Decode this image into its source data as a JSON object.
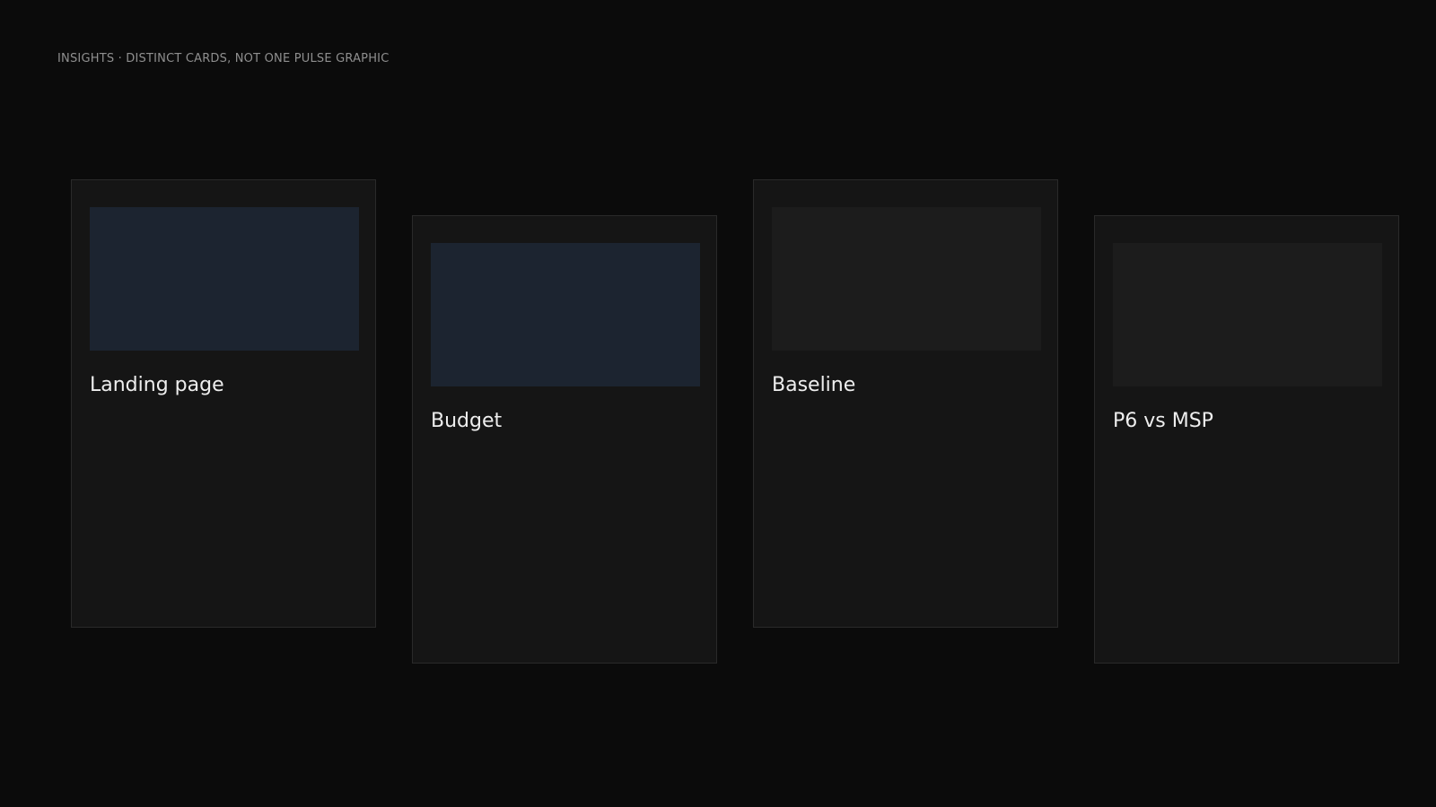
{
  "header": {
    "eyebrow": "INSIGHTS · DISTINCT CARDS, NOT ONE PULSE GRAPHIC"
  },
  "cards": [
    {
      "title": "Landing page",
      "thumb_color": "#1c2430"
    },
    {
      "title": "Budget",
      "thumb_color": "#1c2430"
    },
    {
      "title": "Baseline",
      "thumb_color": "#1c1c1c"
    },
    {
      "title": "P6 vs MSP",
      "thumb_color": "#1c1c1c"
    }
  ],
  "colors": {
    "background": "#0b0b0b",
    "card": "#151515",
    "card_border": "#2a2a2a",
    "eyebrow_text": "#8f8f8f",
    "title_text": "#eeeeee"
  }
}
